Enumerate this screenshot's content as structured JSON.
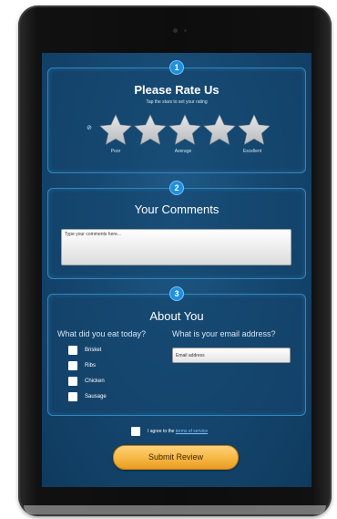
{
  "rating": {
    "step": "1",
    "title": "Please Rate Us",
    "subtitle": "Tap the stars to set your rating",
    "clear_symbol": "⊘",
    "star_icons": [
      "star-icon",
      "star-icon",
      "star-icon",
      "star-icon",
      "star-icon"
    ],
    "labels": {
      "poor": "Poor",
      "average": "Average",
      "excellent": "Excellent"
    }
  },
  "comments": {
    "step": "2",
    "title": "Your Comments",
    "placeholder": "Type your comments here..."
  },
  "about": {
    "step": "3",
    "title": "About You",
    "food_question": "What did you eat today?",
    "food_options": [
      {
        "label": "Brisket",
        "checked": false
      },
      {
        "label": "Ribs",
        "checked": false
      },
      {
        "label": "Chicken",
        "checked": false
      },
      {
        "label": "Sausage",
        "checked": false
      }
    ],
    "email_question": "What is your email address?",
    "email_placeholder": "Email address"
  },
  "terms": {
    "prefix": "I agree to the",
    "link": "terms of service"
  },
  "submit_label": "Submit Review",
  "colors": {
    "screen_bg": "#164871",
    "panel_border": "#2f86c2",
    "step_badge": "#1f8fe0",
    "star": "#b9bcbf",
    "submit": "#f6b742"
  }
}
